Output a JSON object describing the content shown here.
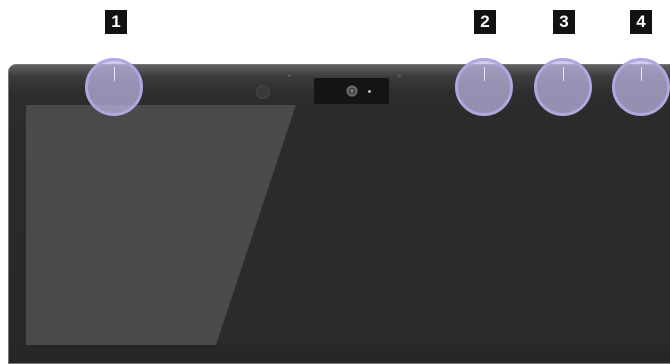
{
  "callouts": [
    {
      "number": "1"
    },
    {
      "number": "2"
    },
    {
      "number": "3"
    },
    {
      "number": "4"
    }
  ],
  "colors": {
    "bezel": "#2c2c2c",
    "screen": "#2b2b2b",
    "callout_fill": "#beb6e6",
    "callout_border": "#b1a7e0",
    "badge_background": "#121212",
    "badge_text": "#ffffff"
  }
}
